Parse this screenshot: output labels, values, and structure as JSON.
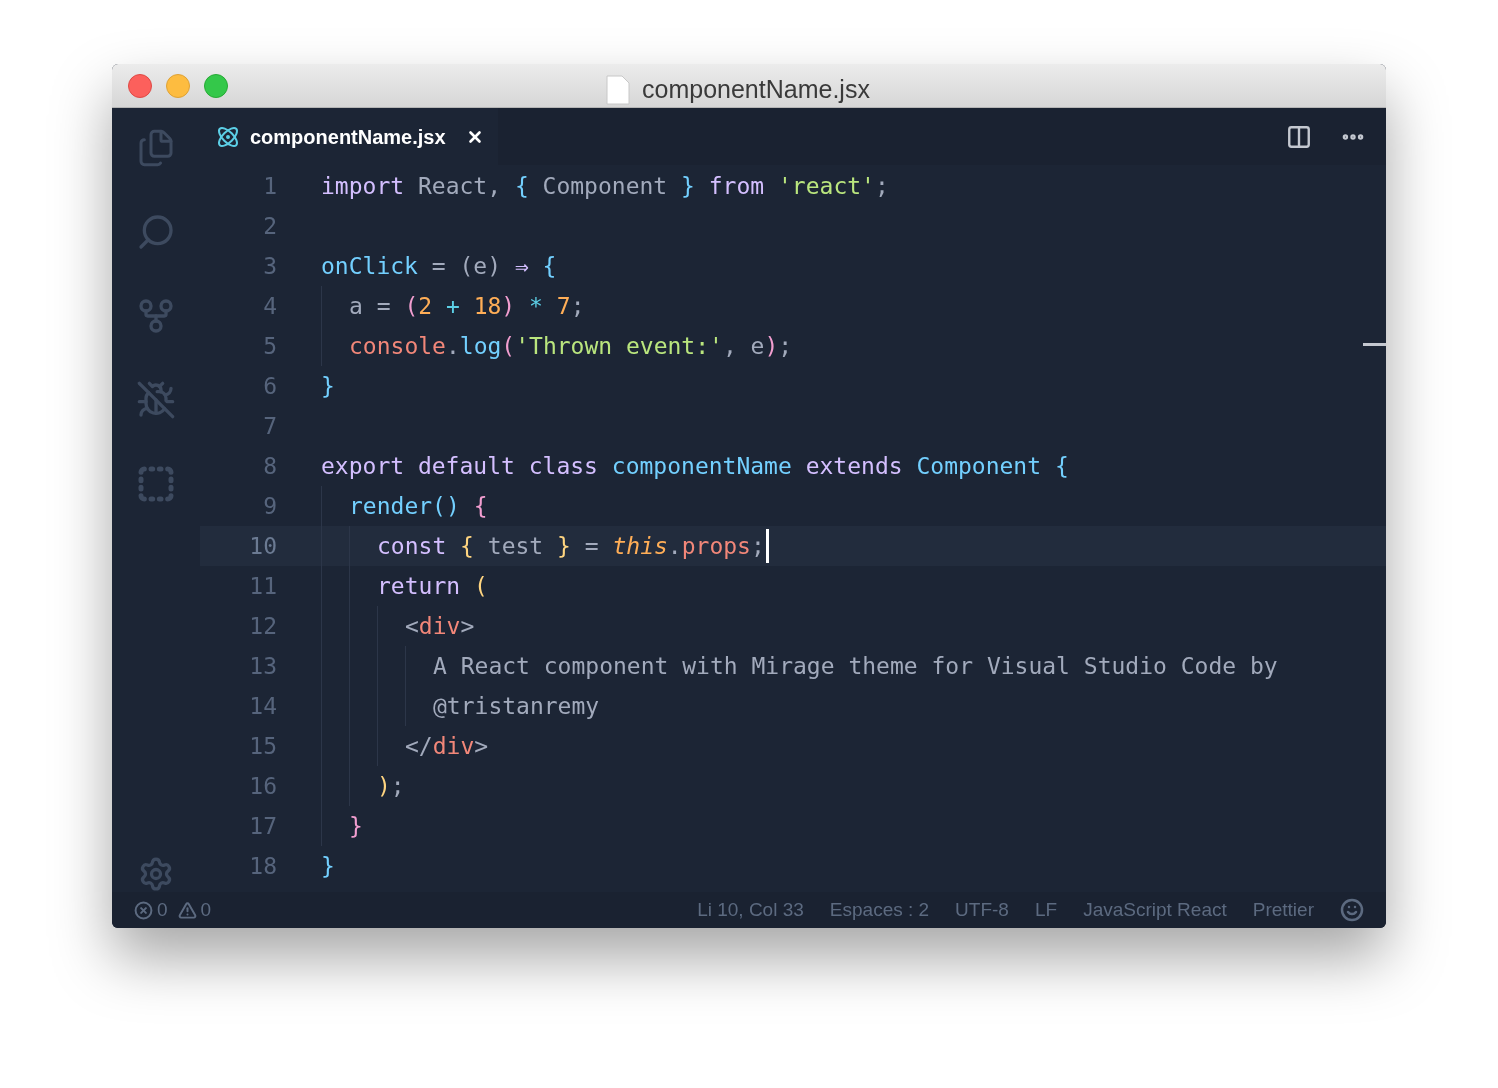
{
  "window": {
    "title": "componentName.jsx"
  },
  "tabs": [
    {
      "label": "componentName.jsx",
      "selected": true
    }
  ],
  "editor": {
    "lines": [
      {
        "number": "1",
        "current": false,
        "tokens": [
          {
            "text": "import",
            "kind": "keyword"
          },
          {
            "text": " React, ",
            "kind": "plain"
          },
          {
            "text": "{",
            "kind": "bracket1"
          },
          {
            "text": " Component ",
            "kind": "plain"
          },
          {
            "text": "}",
            "kind": "bracket1"
          },
          {
            "text": " from ",
            "kind": "keyword"
          },
          {
            "text": "'react'",
            "kind": "string"
          },
          {
            "text": ";",
            "kind": "plain"
          }
        ]
      },
      {
        "number": "2",
        "current": false
      },
      {
        "number": "3",
        "current": false,
        "tokens": [
          {
            "text": "onClick",
            "kind": "function"
          },
          {
            "text": " = (e) ",
            "kind": "plain"
          },
          {
            "text": "⇒",
            "kind": "keyword"
          },
          {
            "text": " {",
            "kind": "bracket1"
          }
        ]
      },
      {
        "number": "4",
        "current": false,
        "tokens": [
          {
            "text": "  a = ",
            "kind": "plain"
          },
          {
            "text": "(",
            "kind": "bracket2"
          },
          {
            "text": "2",
            "kind": "number"
          },
          {
            "text": " + ",
            "kind": "operator"
          },
          {
            "text": "18",
            "kind": "number"
          },
          {
            "text": ")",
            "kind": "bracket2"
          },
          {
            "text": " * ",
            "kind": "operator"
          },
          {
            "text": "7",
            "kind": "number"
          },
          {
            "text": ";",
            "kind": "plain"
          }
        ]
      },
      {
        "number": "5",
        "current": false,
        "tokens": [
          {
            "text": "  console",
            "kind": "tag"
          },
          {
            "text": ".",
            "kind": "plain"
          },
          {
            "text": "log",
            "kind": "function"
          },
          {
            "text": "(",
            "kind": "bracket2"
          },
          {
            "text": "'Thrown event:'",
            "kind": "string"
          },
          {
            "text": ", e",
            "kind": "plain"
          },
          {
            "text": ")",
            "kind": "bracket2"
          },
          {
            "text": ";",
            "kind": "plain"
          }
        ]
      },
      {
        "number": "6",
        "current": false,
        "tokens": [
          {
            "text": "}",
            "kind": "bracket1"
          }
        ]
      },
      {
        "number": "7",
        "current": false
      },
      {
        "number": "8",
        "current": false,
        "tokens": [
          {
            "text": "export default class ",
            "kind": "keyword"
          },
          {
            "text": "componentName",
            "kind": "function"
          },
          {
            "text": " extends ",
            "kind": "keyword"
          },
          {
            "text": "Component",
            "kind": "function"
          },
          {
            "text": " {",
            "kind": "bracket1"
          }
        ]
      },
      {
        "number": "9",
        "current": false,
        "tokens": [
          {
            "text": "  render",
            "kind": "function"
          },
          {
            "text": "()",
            "kind": "bracket1"
          },
          {
            "text": " {",
            "kind": "bracket2"
          }
        ]
      },
      {
        "number": "10",
        "current": true,
        "tokens": [
          {
            "text": "    const ",
            "kind": "keyword"
          },
          {
            "text": "{",
            "kind": "bracket3"
          },
          {
            "text": " test ",
            "kind": "plain"
          },
          {
            "text": "}",
            "kind": "bracket3"
          },
          {
            "text": " = ",
            "kind": "plain"
          },
          {
            "text": "this",
            "kind": "this"
          },
          {
            "text": ".",
            "kind": "plain"
          },
          {
            "text": "props",
            "kind": "tag"
          },
          {
            "text": ";",
            "kind": "plain"
          }
        ]
      },
      {
        "number": "11",
        "current": false,
        "tokens": [
          {
            "text": "    return ",
            "kind": "keyword"
          },
          {
            "text": "(",
            "kind": "bracket3"
          }
        ]
      },
      {
        "number": "12",
        "current": false,
        "tokens": [
          {
            "text": "      <",
            "kind": "plain"
          },
          {
            "text": "div",
            "kind": "tag"
          },
          {
            "text": ">",
            "kind": "plain"
          }
        ]
      },
      {
        "number": "13",
        "current": false,
        "tokens": [
          {
            "text": "        A React component with Mirage theme for Visual Studio Code by",
            "kind": "plain"
          }
        ]
      },
      {
        "number": "14",
        "current": false,
        "tokens": [
          {
            "text": "        @tristanremy",
            "kind": "plain"
          }
        ]
      },
      {
        "number": "15",
        "current": false,
        "tokens": [
          {
            "text": "      </",
            "kind": "plain"
          },
          {
            "text": "div",
            "kind": "tag"
          },
          {
            "text": ">",
            "kind": "plain"
          }
        ]
      },
      {
        "number": "16",
        "current": false,
        "tokens": [
          {
            "text": "    )",
            "kind": "bracket3"
          },
          {
            "text": ";",
            "kind": "plain"
          }
        ]
      },
      {
        "number": "17",
        "current": false,
        "tokens": [
          {
            "text": "  }",
            "kind": "bracket2"
          }
        ]
      },
      {
        "number": "18",
        "current": false,
        "tokens": [
          {
            "text": "}",
            "kind": "bracket1"
          }
        ]
      }
    ]
  },
  "status_bar": {
    "errors": "0",
    "warnings": "0",
    "items": [
      "Li 10, Col 33",
      "Espaces : 2",
      "UTF-8",
      "LF",
      "JavaScript React",
      "Prettier"
    ]
  }
}
